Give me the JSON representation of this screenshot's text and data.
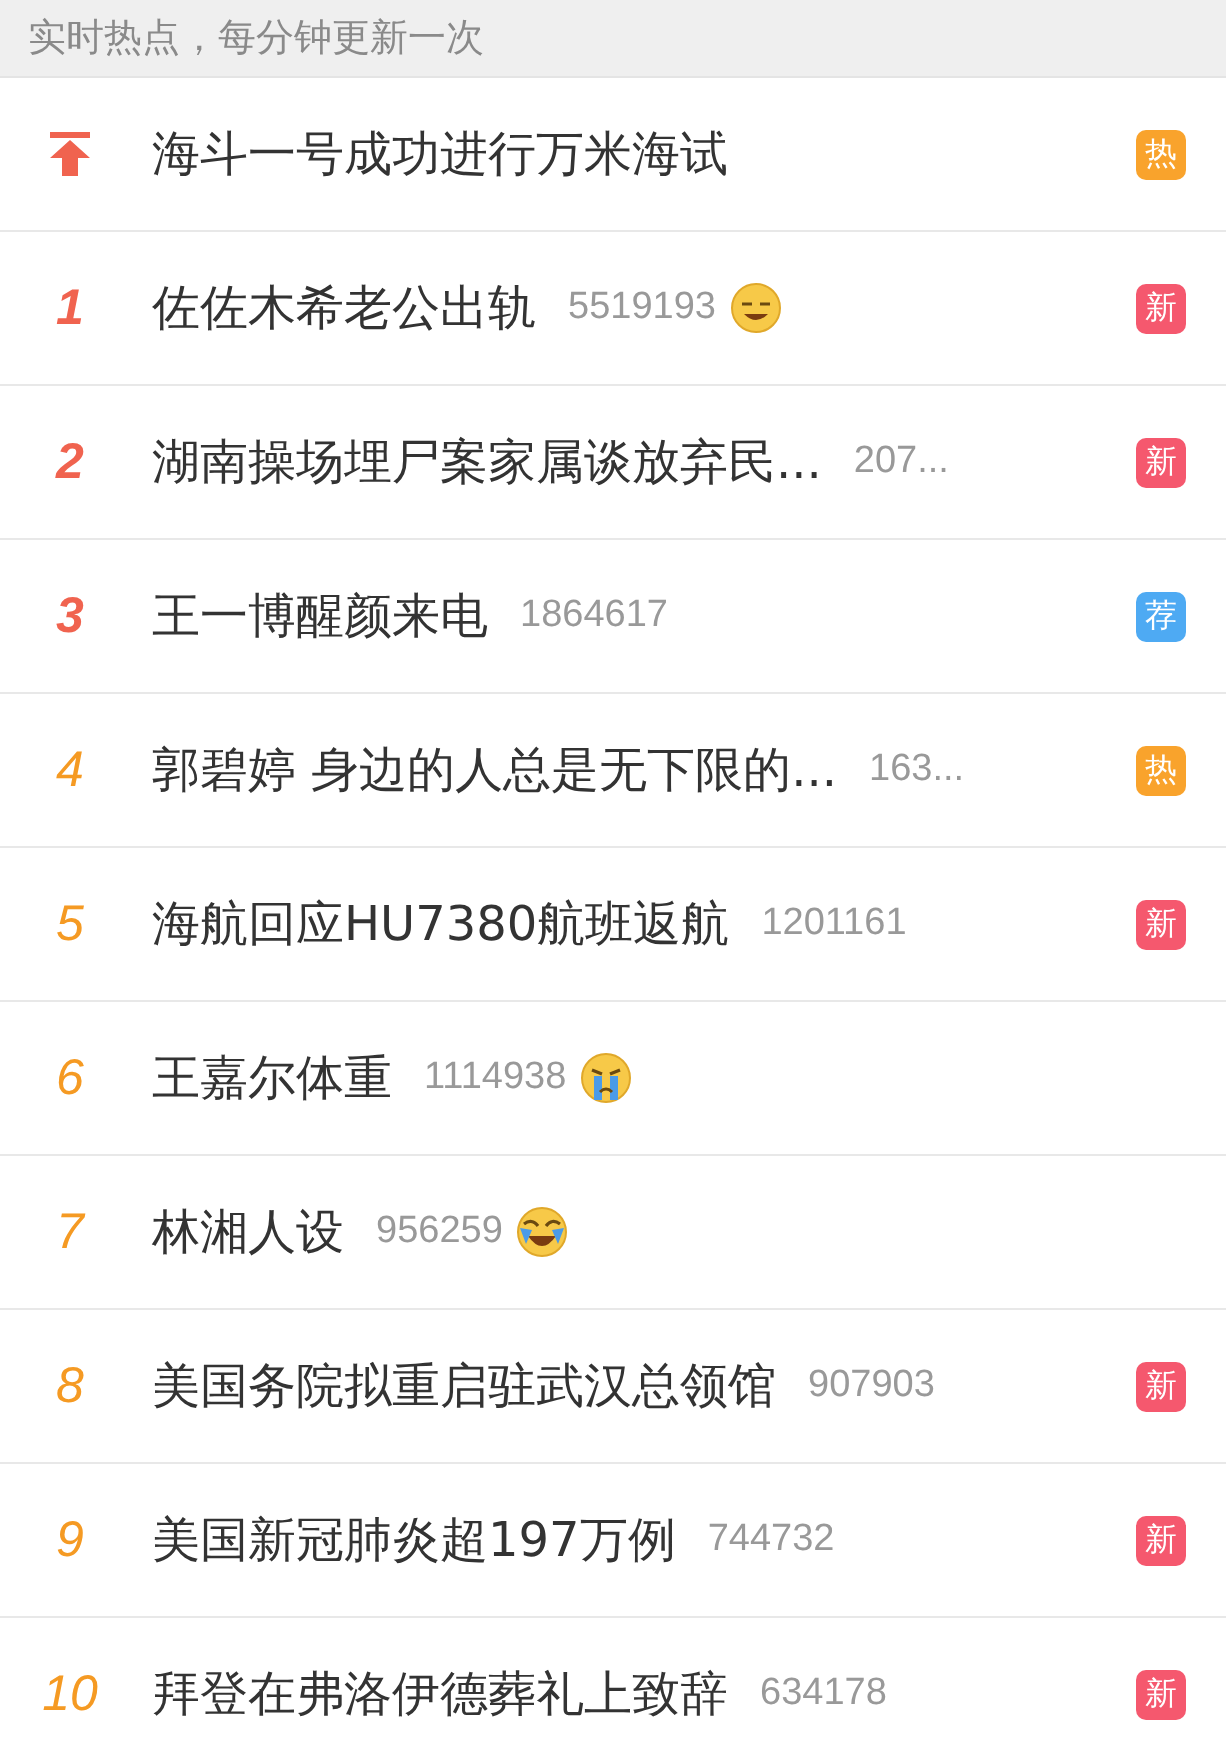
{
  "header": {
    "text": "实时热点，每分钟更新一次"
  },
  "items": [
    {
      "rank": {
        "kind": "pin",
        "color": "#f0634f"
      },
      "title": "海斗一号成功进行万米海试",
      "badge": {
        "text": "热",
        "color": "#f9a32c"
      }
    },
    {
      "rank": {
        "kind": "number",
        "text": "1",
        "color": "#f0634f"
      },
      "title": "佐佐木希老公出轨",
      "count": "5519193",
      "emoji": {
        "kind": "sleepy"
      },
      "badge": {
        "text": "新",
        "color": "#f5586e"
      }
    },
    {
      "rank": {
        "kind": "number",
        "text": "2",
        "color": "#f0634f"
      },
      "title": "湖南操场埋尸案家属谈放弃民...",
      "count": "207...",
      "badge": {
        "text": "新",
        "color": "#f5586e"
      }
    },
    {
      "rank": {
        "kind": "number",
        "text": "3",
        "color": "#f0634f"
      },
      "title": "王一博醒颜来电",
      "count": "1864617",
      "badge": {
        "text": "荐",
        "color": "#4eaaf3"
      }
    },
    {
      "rank": {
        "kind": "number",
        "text": "4",
        "color": "#f59a23"
      },
      "title": "郭碧婷 身边的人总是无下限的...",
      "count": "163...",
      "badge": {
        "text": "热",
        "color": "#f9a32c"
      }
    },
    {
      "rank": {
        "kind": "number",
        "text": "5",
        "color": "#f59a23"
      },
      "title": "海航回应HU7380航班返航",
      "count": "1201161",
      "badge": {
        "text": "新",
        "color": "#f5586e"
      }
    },
    {
      "rank": {
        "kind": "number",
        "text": "6",
        "color": "#f59a23"
      },
      "title": "王嘉尔体重",
      "count": "1114938",
      "emoji": {
        "kind": "crying"
      }
    },
    {
      "rank": {
        "kind": "number",
        "text": "7",
        "color": "#f59a23"
      },
      "title": "林湘人设",
      "count": "956259",
      "emoji": {
        "kind": "laughing"
      }
    },
    {
      "rank": {
        "kind": "number",
        "text": "8",
        "color": "#f59a23"
      },
      "title": "美国务院拟重启驻武汉总领馆",
      "count": "907903",
      "badge": {
        "text": "新",
        "color": "#f5586e"
      }
    },
    {
      "rank": {
        "kind": "number",
        "text": "9",
        "color": "#f59a23"
      },
      "title": "美国新冠肺炎超197万例",
      "count": "744732",
      "badge": {
        "text": "新",
        "color": "#f5586e"
      }
    },
    {
      "rank": {
        "kind": "number",
        "text": "10",
        "color": "#f59a23"
      },
      "title": "拜登在弗洛伊德葬礼上致辞",
      "count": "634178",
      "badge": {
        "text": "新",
        "color": "#f5586e"
      }
    }
  ]
}
